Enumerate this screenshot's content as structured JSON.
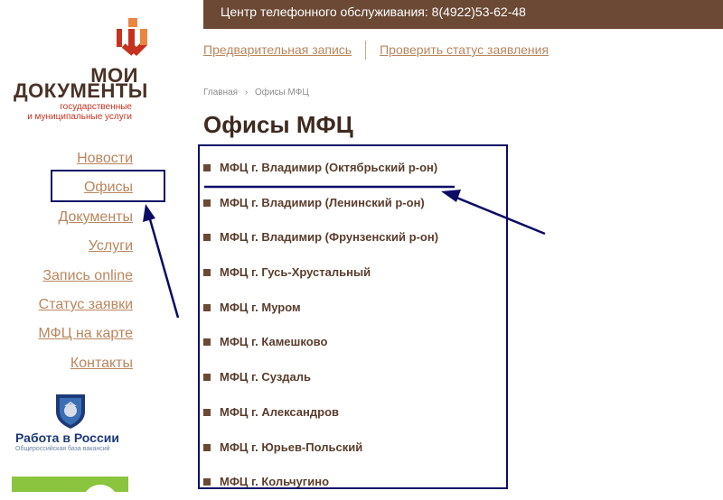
{
  "header": {
    "phone_text": "Центр телефонного обслуживания: 8(4922)53-62-48",
    "links": [
      "Предварительная запись",
      "Проверить статус заявления"
    ]
  },
  "logo": {
    "line1": "МОИ",
    "line2": "ДОКУМЕНТЫ",
    "sub1": "государственные",
    "sub2": "и муниципальные услуги",
    "colors": {
      "red": "#c7311f",
      "orange": "#e9863f",
      "brown": "#4a3226"
    }
  },
  "nav": {
    "items": [
      "Новости",
      "Офисы",
      "Документы",
      "Услуги",
      "Запись online",
      "Статус заявки",
      "МФЦ на карте",
      "Контакты"
    ],
    "active_index": 1
  },
  "rabota": {
    "title": "Работа в России",
    "subtitle": "Общероссийская база вакансий"
  },
  "breadcrumb": {
    "home": "Главная",
    "separator": "›",
    "current": "Офисы МФЦ"
  },
  "page": {
    "title": "Офисы МФЦ"
  },
  "offices": [
    "МФЦ г. Владимир (Октябрьский р-он)",
    "МФЦ г. Владимир (Ленинский р-он)",
    "МФЦ г. Владимир (Фрунзенский р-он)",
    "МФЦ г. Гусь-Хрустальный",
    "МФЦ г. Муром",
    "МФЦ г. Камешково",
    "МФЦ г. Суздаль",
    "МФЦ г. Александров",
    "МФЦ г. Юрьев-Польский",
    "МФЦ г. Кольчугино"
  ],
  "theme": {
    "brown": "#6b4934",
    "link": "#b9865d",
    "annotation": "#0c0c66",
    "green": "#8bc43f"
  }
}
